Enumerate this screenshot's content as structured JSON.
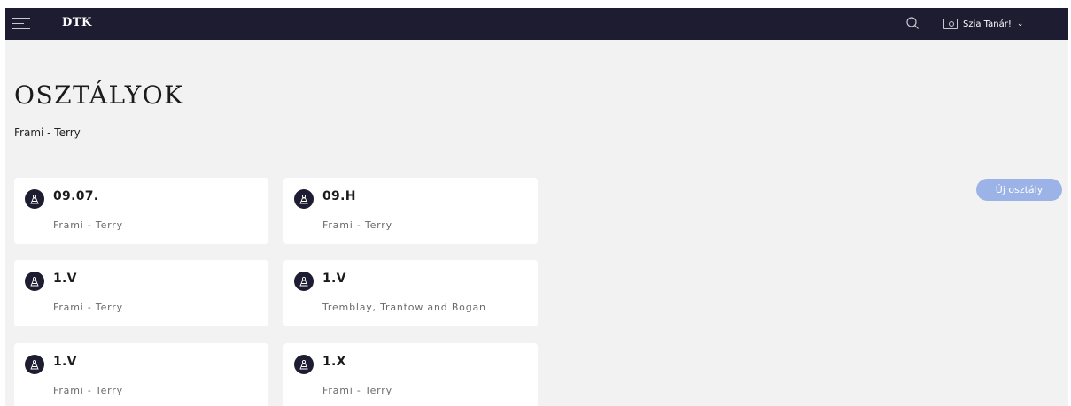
{
  "header": {
    "brand": "DTK",
    "user_greeting": "Szia Tanár!",
    "background_color": "#1d1c30"
  },
  "page": {
    "title": "OSZTÁLYOK",
    "subtitle": "Frami - Terry",
    "new_button_label": "Új osztály",
    "new_button_color": "#9bb3e6"
  },
  "classes": [
    {
      "name": "09.07.",
      "school": "Frami - Terry"
    },
    {
      "name": "09.H",
      "school": "Frami - Terry"
    },
    {
      "name": "1.V",
      "school": "Frami - Terry"
    },
    {
      "name": "1.V",
      "school": "Tremblay, Trantow and Bogan"
    },
    {
      "name": "1.V",
      "school": "Frami - Terry"
    },
    {
      "name": "1.X",
      "school": "Frami - Terry"
    }
  ]
}
